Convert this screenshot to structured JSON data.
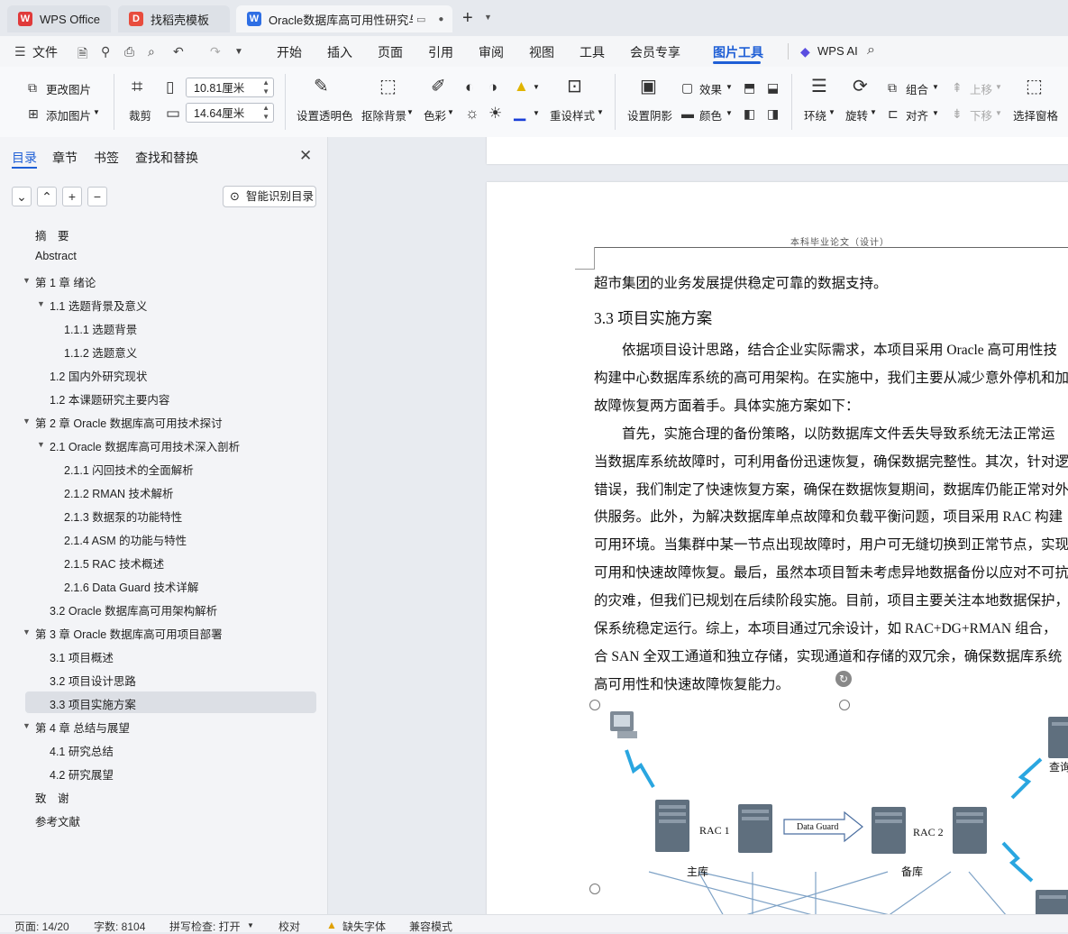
{
  "tabs": [
    {
      "label": "WPS Office",
      "icon": "wps-logo-icon"
    },
    {
      "label": "找稻壳模板",
      "icon": "docer-icon"
    },
    {
      "label": "Oracle数据库高可用性研究与",
      "icon": "writer-doc-icon"
    }
  ],
  "menu": {
    "file": "文件",
    "items": [
      "开始",
      "插入",
      "页面",
      "引用",
      "审阅",
      "视图",
      "工具",
      "会员专享",
      "图片工具"
    ],
    "active": "图片工具",
    "wps_ai": "WPS AI"
  },
  "ribbon": {
    "change_image": "更改图片",
    "add_image": "添加图片",
    "crop": "裁剪",
    "width_value": "10.81厘米",
    "height_value": "14.64厘米",
    "set_transparent": "设置透明色",
    "remove_bg": "抠除背景",
    "color": "色彩",
    "reset_style": "重设样式",
    "set_shadow": "设置阴影",
    "effect": "效果",
    "fill_color": "颜色",
    "wrap": "环绕",
    "rotate": "旋转",
    "group": "组合",
    "align": "对齐",
    "move_up": "上移",
    "move_down": "下移",
    "select_pane": "选择窗格"
  },
  "sidebar": {
    "tabs": [
      "目录",
      "章节",
      "书签",
      "查找和替换"
    ],
    "smart_btn": "智能识别目录",
    "toc": [
      "摘　要",
      "Abstract",
      "第 1 章  绪论",
      "1.1  选题背景及意义",
      "1.1.1  选题背景",
      "1.1.2  选题意义",
      "1.2  国内外研究现状",
      "1.2 本课题研究主要内容",
      "第 2 章  Oracle 数据库高可用技术探讨",
      "2.1 Oracle 数据库高可用技术深入剖析",
      "2.1.1  闪回技术的全面解析",
      "2.1.2 RMAN 技术解析",
      "2.1.3  数据泵的功能特性",
      "2.1.4 ASM 的功能与特性",
      "2.1.5 RAC 技术概述",
      "2.1.6 Data Guard 技术详解",
      "3.2 Oracle 数据库高可用架构解析",
      "第 3 章  Oracle 数据库高可用项目部署",
      "3.1  项目概述",
      "3.2  项目设计思路",
      "3.3  项目实施方案",
      "第 4 章  总结与展望",
      "4.1  研究总结",
      "4.2  研究展望",
      "致　谢",
      "参考文献"
    ]
  },
  "document": {
    "page_header": "本科毕业论文（设计）",
    "line0": "超市集团的业务发展提供稳定可靠的数据支持。",
    "heading": "3.3  项目实施方案",
    "lines": [
      "　　依据项目设计思路，结合企业实际需求，本项目采用 Oracle 高可用性技",
      "构建中心数据库系统的高可用架构。在实施中，我们主要从减少意外停机和加",
      "故障恢复两方面着手。具体实施方案如下：",
      "　　首先，实施合理的备份策略，以防数据库文件丢失导致系统无法正常运",
      "当数据库系统故障时，可利用备份迅速恢复，确保数据完整性。其次，针对逻",
      "错误，我们制定了快速恢复方案，确保在数据恢复期间，数据库仍能正常对外",
      "供服务。此外，为解决数据库单点故障和负载平衡问题，项目采用 RAC 构建",
      "可用环境。当集群中某一节点出现故障时，用户可无缝切换到正常节点，实现",
      "可用和快速故障恢复。最后，虽然本项目暂未考虑异地数据备份以应对不可抗",
      "的灾难，但我们已规划在后续阶段实施。目前，项目主要关注本地数据保护，",
      "保系统稳定运行。综上，本项目通过冗余设计，如 RAC+DG+RMAN 组合，",
      "合 SAN 全双工通道和独立存储，实现通道和存储的双冗余，确保数据库系统",
      "高可用性和快速故障恢复能力。"
    ],
    "diagram": {
      "rac1": "RAC 1",
      "rac2": "RAC 2",
      "dataguard": "Data Guard",
      "primary": "主库",
      "standby": "备库",
      "query": "查询"
    }
  },
  "status": {
    "page": "页面: 14/20",
    "words": "字数: 8104",
    "spell": "拼写检查: 打开",
    "proof": "校对",
    "missing_font": "缺失字体",
    "compat": "兼容模式"
  }
}
